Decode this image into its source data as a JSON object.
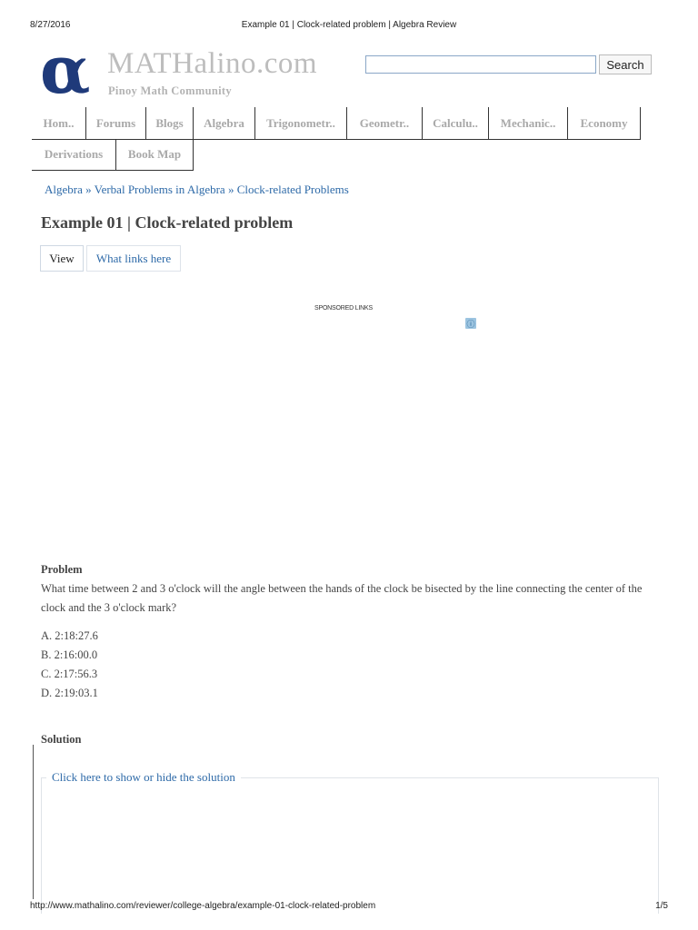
{
  "print_header": {
    "date": "8/27/2016",
    "title": "Example 01 | Clock-related problem | Algebra Review"
  },
  "site": {
    "logo_glyph": "α",
    "name": "MATHalino.com",
    "tagline": "Pinoy Math Community"
  },
  "search": {
    "value": "",
    "button_label": "Search"
  },
  "nav": {
    "row1": [
      "Hom..",
      "Forums",
      "Blogs",
      "Algebra",
      "Trigonometr..",
      "Geometr..",
      "Calculu..",
      "Mechanic..",
      "Economy"
    ],
    "row2": [
      "Derivations",
      "Book Map"
    ]
  },
  "breadcrumb": {
    "items": [
      "Algebra",
      "Verbal Problems in Algebra",
      "Clock-related Problems"
    ],
    "separator": "»"
  },
  "page": {
    "title": "Example 01 | Clock-related problem"
  },
  "tabs": {
    "view": "View",
    "what_links_here": "What links here"
  },
  "ad": {
    "label": "SPONSORED LINKS",
    "info_icon": "ⓘ"
  },
  "problem": {
    "heading": "Problem",
    "text": "What time between 2 and 3 o'clock will the angle between the hands of the clock be bisected by the line connecting the center of the clock and the 3 o'clock mark?",
    "choices": [
      "A. 2:18:27.6",
      "B. 2:16:00.0",
      "C. 2:17:56.3",
      "D. 2:19:03.1"
    ]
  },
  "solution": {
    "heading": "Solution",
    "toggle_label": "Click here to show or hide the solution"
  },
  "print_footer": {
    "url": "http://www.mathalino.com/reviewer/college-algebra/example-01-clock-related-problem",
    "page": "1/5"
  },
  "colors": {
    "logo": "#1f3a7a",
    "link": "#2e6aa8",
    "nav_text": "#a9a9a9",
    "site_name": "#bdbdbd"
  }
}
